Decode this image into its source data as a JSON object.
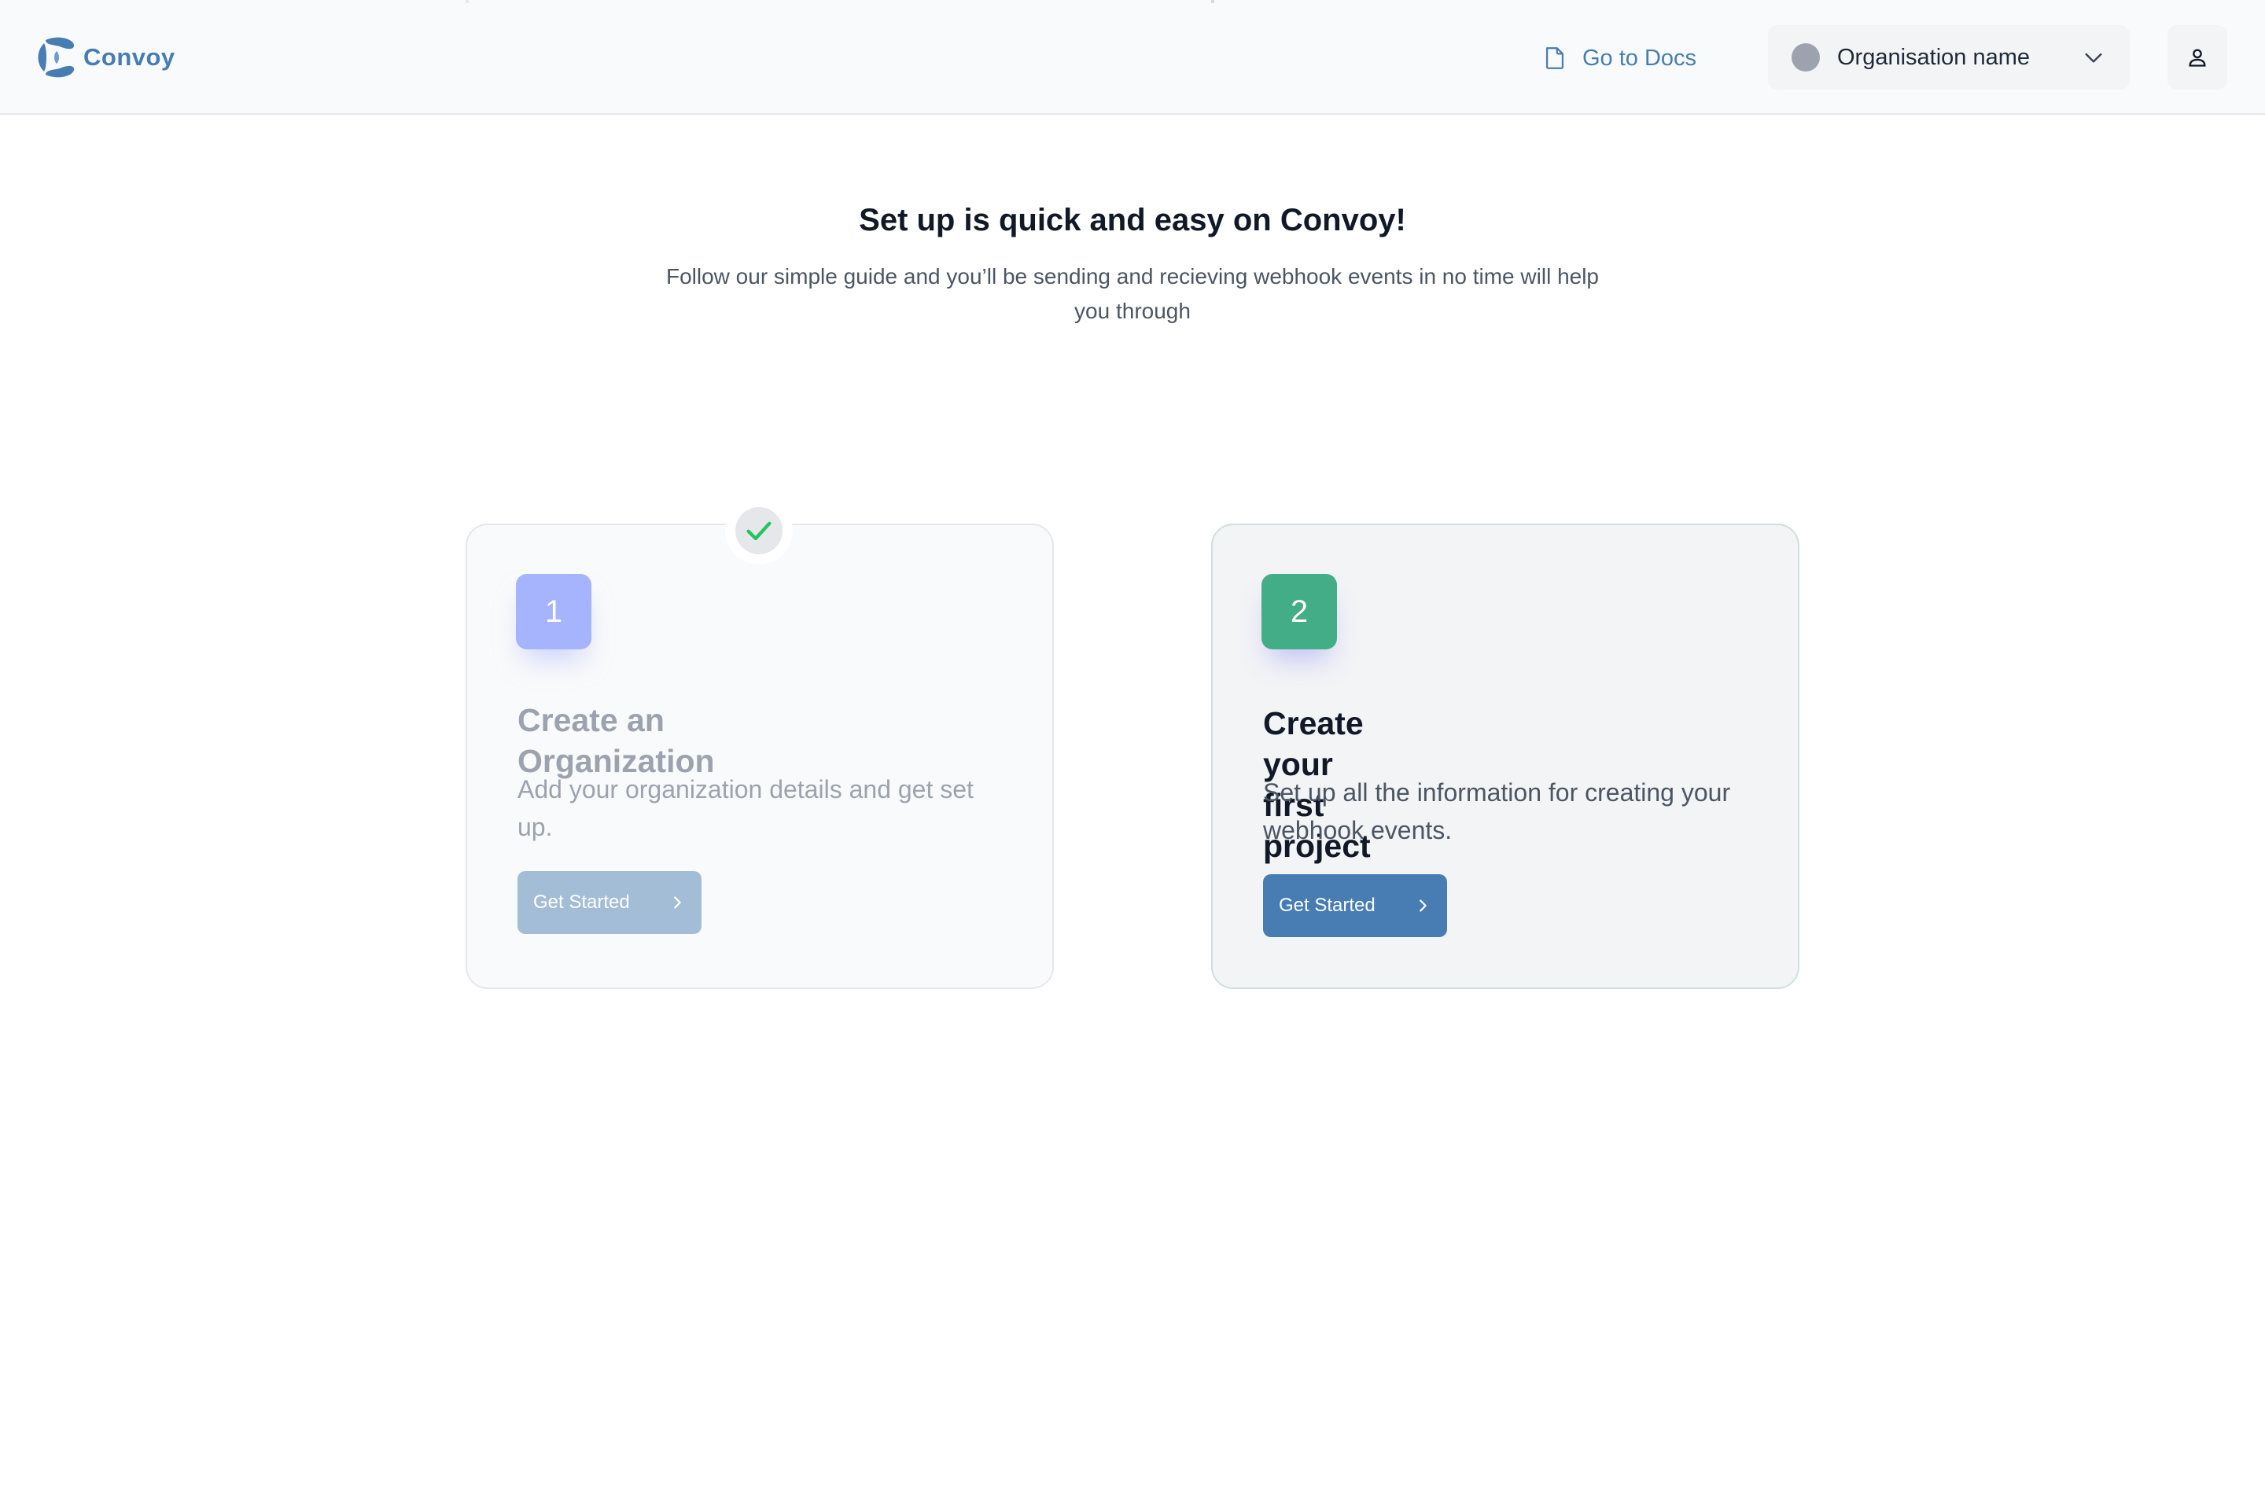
{
  "header": {
    "brand_name": "Convoy",
    "docs_link_label": "Go to Docs",
    "org_selector": {
      "selected": "Organisation name"
    }
  },
  "hero": {
    "title": "Set up is quick and easy on Convoy!",
    "subtitle": "Follow our simple guide and you’ll be sending and recieving webhook events in no time will help you through"
  },
  "steps": [
    {
      "number": "1",
      "title": "Create an Organization",
      "description": "Add your organization details and get set up.",
      "button_label": "Get Started",
      "completed": true
    },
    {
      "number": "2",
      "title": "Create your first project",
      "description": "Set up all the information for creating your webhook events.",
      "button_label": "Get Started",
      "completed": false
    }
  ],
  "colors": {
    "brand": "#477db3",
    "step1_badge": "#a5b4fc",
    "step2_badge": "#42ad86",
    "check": "#22c55e"
  },
  "icons": {
    "logo": "convoy-logo-icon",
    "docs": "document-icon",
    "org_dropdown": "chevron-down-icon",
    "user": "user-icon",
    "step_complete": "check-icon",
    "button_arrow": "chevron-right-icon"
  }
}
